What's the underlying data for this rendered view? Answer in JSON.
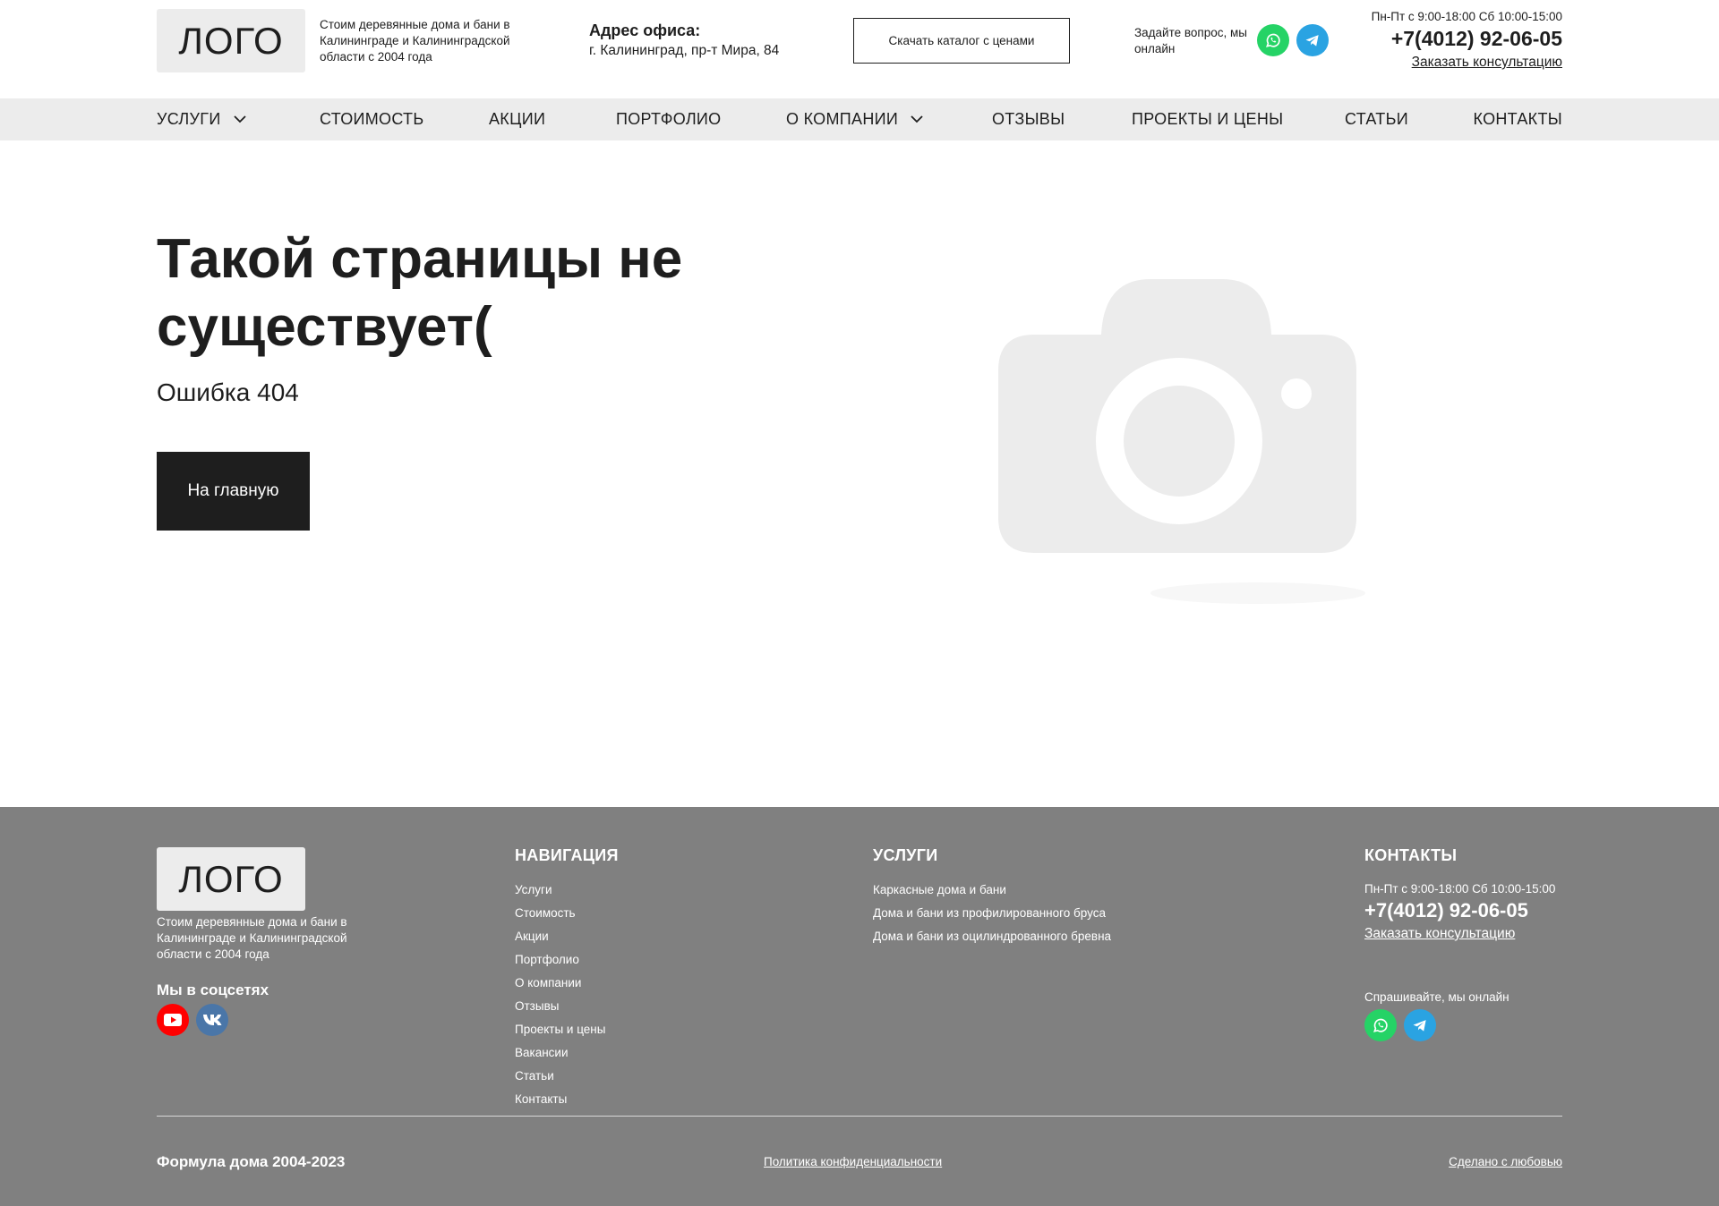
{
  "header": {
    "logo": "ЛОГО",
    "tagline": "Стоим деревянные дома и бани в Калининграде и Калининградской области с 2004 года",
    "address_title": "Адрес офиса:",
    "address": "г. Калининград, пр-т Мира, 84",
    "catalog_button": "Скачать каталог с ценами",
    "ask": "Задайте вопрос, мы онлайн",
    "hours": "Пн-Пт с 9:00-18:00  Сб 10:00-15:00",
    "phone": "+7(4012) 92-06-05",
    "consult_link": "Заказать консультацию"
  },
  "nav": {
    "items": [
      {
        "label": "Услуги",
        "has_dropdown": true
      },
      {
        "label": "Стоимость"
      },
      {
        "label": "Акции"
      },
      {
        "label": "Портфолио"
      },
      {
        "label": "О компании",
        "has_dropdown": true
      },
      {
        "label": "Отзывы"
      },
      {
        "label": "Проекты и цены"
      },
      {
        "label": "Статьи"
      },
      {
        "label": "Контакты"
      }
    ]
  },
  "main": {
    "title": "Такой страницы не существует(",
    "subtitle": "Ошибка 404",
    "home_button": "На главную",
    "image_icon": "camera-placeholder-icon"
  },
  "footer": {
    "logo": "ЛОГО",
    "tagline": "Стоим деревянные дома и бани в Калининграде и Калининградской области с 2004 года",
    "social_title": "Мы в соцсетях",
    "nav_title": "Навигация",
    "nav_links": [
      "Услуги",
      "Стоимость",
      "Акции",
      "Портфолио",
      "О компании",
      "Отзывы",
      "Проекты и цены",
      "Вакансии",
      "Статьи",
      "Контакты"
    ],
    "services_title": "Услуги",
    "services_links": [
      "Каркасные дома и бани",
      "Дома и бани из профилированного бруса",
      "Дома и бани из оцилиндрованного бревна"
    ],
    "contacts_title": "Контакты",
    "hours": "Пн-Пт с 9:00-18:00  Сб 10:00-15:00",
    "phone": "+7(4012) 92-06-05",
    "consult_link": "Заказать консультацию",
    "ask": "Спрашивайте, мы онлайн",
    "copyright": "Формула дома 2004-2023",
    "policy": "Политика конфиденциальности ",
    "made_with": "Сделано с любовью"
  },
  "colors": {
    "dark": "#1e1e1e",
    "nav_bg": "#ececec",
    "footer_bg": "#808080",
    "whatsapp": "#25d366",
    "telegram": "#2aa3e2",
    "youtube": "#ff0000",
    "vk": "#4a76a8"
  }
}
